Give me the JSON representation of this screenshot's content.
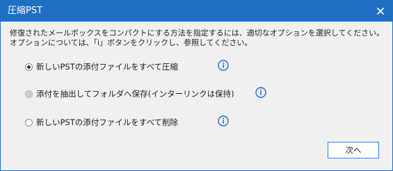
{
  "window": {
    "title": "圧縮PST",
    "close_label": "×"
  },
  "description": {
    "line1": "修復されたメールボックスをコンパクトにする方法を指定するには、適切なオプションを選択してください。",
    "line2": "オプションについては、「i」ボタンをクリックし、参照してください。"
  },
  "options": [
    {
      "label": "新しいPSTの添付ファイルをすべて圧縮",
      "selected": true,
      "enabled": true,
      "info_icon": "info-icon"
    },
    {
      "label": "添付を抽出してフォルダへ保存(インターリンクは保持)",
      "selected": false,
      "enabled": false,
      "info_icon": "info-icon"
    },
    {
      "label": "新しいPSTの添付ファイルをすべて削除",
      "selected": false,
      "enabled": true,
      "info_icon": "info-icon"
    }
  ],
  "footer": {
    "next_label": "次へ"
  },
  "colors": {
    "titlebar": "#1f6fc5",
    "info_icon": "#1f6fc5",
    "button_border": "#3a80d0"
  }
}
